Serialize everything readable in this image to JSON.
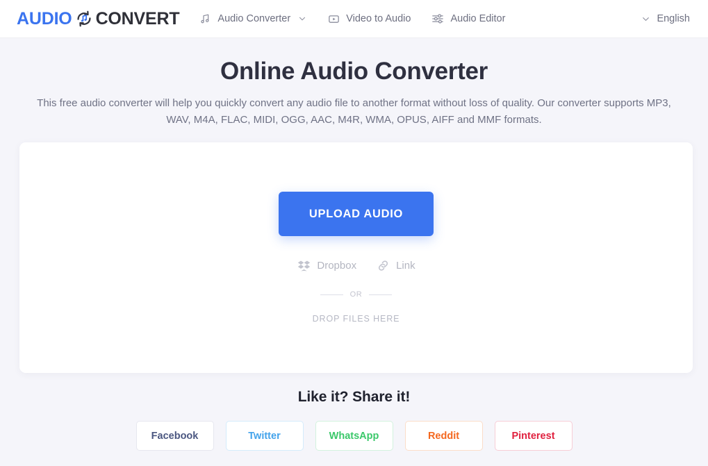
{
  "header": {
    "logo": {
      "part1": "AUDIO",
      "part2": "CONVERT",
      "icon": "audio-refresh-icon"
    },
    "nav": [
      {
        "label": "Audio Converter",
        "icon": "music-note-icon",
        "has_caret": true
      },
      {
        "label": "Video to Audio",
        "icon": "play-square-icon",
        "has_caret": false
      },
      {
        "label": "Audio Editor",
        "icon": "equalizer-icon",
        "has_caret": false
      }
    ],
    "language": {
      "label": "English",
      "icon": "chevron-down-icon"
    }
  },
  "hero": {
    "title": "Online Audio Converter",
    "subtitle": "This free audio converter will help you quickly convert any audio file to another format without loss of quality. Our converter supports MP3, WAV, M4A, FLAC, MIDI, OGG, AAC, M4R, WMA, OPUS, AIFF and MMF formats."
  },
  "uploader": {
    "upload_label": "UPLOAD AUDIO",
    "sources": [
      {
        "label": "Dropbox",
        "icon": "dropbox-icon"
      },
      {
        "label": "Link",
        "icon": "link-icon"
      }
    ],
    "or_label": "OR",
    "drop_label": "DROP FILES HERE"
  },
  "share": {
    "title": "Like it? Share it!",
    "buttons": [
      {
        "label": "Facebook",
        "color": "#4a5680"
      },
      {
        "label": "Twitter",
        "color": "#43a3eb"
      },
      {
        "label": "WhatsApp",
        "color": "#3bc86a"
      },
      {
        "label": "Reddit",
        "color": "#f4681f"
      },
      {
        "label": "Pinterest",
        "color": "#e0213f"
      }
    ]
  },
  "colors": {
    "accent": "#3b74ef",
    "page_background": "#f5f5fa",
    "card_background": "#ffffff",
    "title": "#2f3040",
    "body_text": "#6f7285"
  }
}
